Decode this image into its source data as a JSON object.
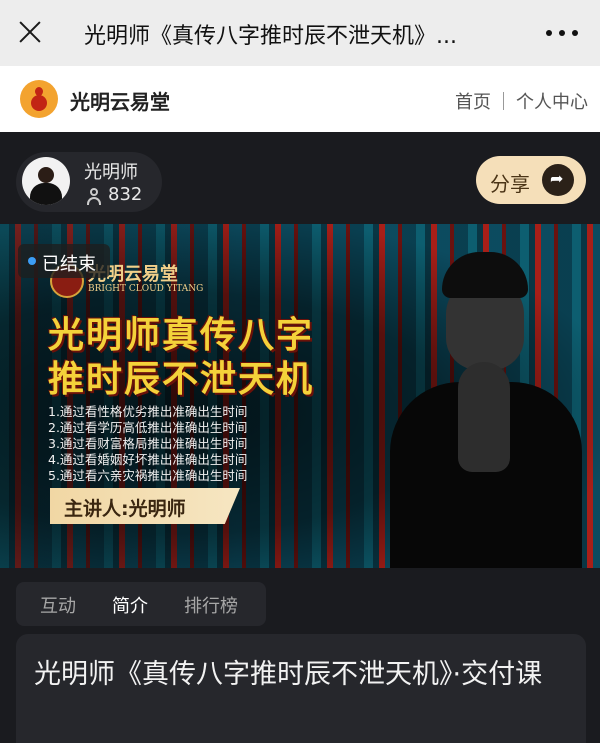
{
  "topbar": {
    "title": "光明师《真传八字推时辰不泄天机》..."
  },
  "site": {
    "name": "光明云易堂",
    "nav": {
      "home": "首页",
      "personal_center": "个人中心"
    }
  },
  "author": {
    "name": "光明师",
    "viewer_count": "832"
  },
  "share": {
    "label": "分享"
  },
  "banner": {
    "status_badge": "已结束",
    "brand_cn": "光明云易堂",
    "brand_en": "BRIGHT CLOUD YITANG",
    "headline_line1": "光明师真传八字",
    "headline_line2": "推时辰不泄天机",
    "points": [
      "1.通过看性格优劣推出准确出生时间",
      "2.通过看学历高低推出准确出生时间",
      "3.通过看财富格局推出准确出生时间",
      "4.通过看婚姻好坏推出准确出生时间",
      "5.通过看六亲灾祸推出准确出生时间"
    ],
    "speaker": "主讲人:光明师"
  },
  "tabs": [
    {
      "label": "互动",
      "active": false
    },
    {
      "label": "简介",
      "active": true
    },
    {
      "label": "排行榜",
      "active": false
    }
  ],
  "description": {
    "title": "光明师《真传八字推时辰不泄天机》·交付课"
  }
}
